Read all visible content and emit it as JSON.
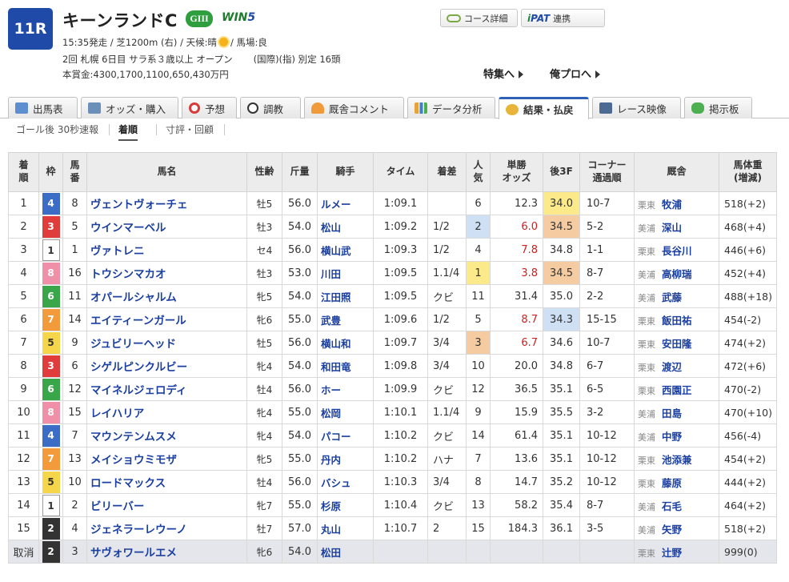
{
  "race": {
    "number": "11R",
    "name": "キーンランドC",
    "grade": "GIII",
    "win5_a": "WIN",
    "win5_b": "5",
    "info1_a": "15:35発走 / 芝1200m (右) / 天候:晴",
    "info1_b": "/ 馬場:良",
    "info2": "2回 札幌 6日目 サラ系３歳以上 オープン",
    "info2_class": "(国際)(指) 別定 16頭",
    "prize": "本賞金:4300,1700,1100,650,430万円"
  },
  "buttons": {
    "course": "コース詳細",
    "ipat_logo_a": "i",
    "ipat_logo_b": "PAT",
    "ipat_text": "連携"
  },
  "links": {
    "tokusyu": "特集へ",
    "orepro": "俺プロへ"
  },
  "tabs": [
    {
      "label": "出馬表"
    },
    {
      "label": "オッズ・購入"
    },
    {
      "label": "予想"
    },
    {
      "label": "調教"
    },
    {
      "label": "厩舎コメント"
    },
    {
      "label": "データ分析"
    },
    {
      "label": "結果・払戻"
    },
    {
      "label": "レース映像"
    },
    {
      "label": "掲示板"
    }
  ],
  "subtabs": [
    {
      "label": "ゴール後 30秒速報"
    },
    {
      "label": "着順"
    },
    {
      "label": "寸評・回顧"
    }
  ],
  "columns": {
    "rank": "着順",
    "waku": "枠",
    "umaban": "馬番",
    "horse": "馬名",
    "sex": "性齢",
    "weight": "斤量",
    "jockey": "騎手",
    "time": "タイム",
    "margin": "着差",
    "pop": "人気",
    "odds": "単勝オッズ",
    "last3f": "後3F",
    "corner": "コーナー通過順",
    "trainer": "厩舎",
    "bw": "馬体重(増減)"
  },
  "colors": {
    "waku1": "#ffffff",
    "waku2": "#333333",
    "waku3": "#e03c3c",
    "waku4": "#3b6cc6",
    "waku5": "#f5d54a",
    "waku6": "#3aa64a",
    "waku7": "#f39a3a",
    "waku8": "#f08fa8",
    "highlight_yellow": "#fbe98a",
    "highlight_orange": "#f5cba2",
    "highlight_blue": "#cfe0f5",
    "odds_red": "#d41c1c"
  },
  "rows": [
    {
      "rank": "1",
      "waku": "4",
      "umaban": "8",
      "horse": "ヴェントヴォーチェ",
      "sex": "牡5",
      "weight": "56.0",
      "jockey": "ルメー",
      "time": "1:09.1",
      "margin": "",
      "pop": "6",
      "odds": "12.3",
      "last3f": "34.0",
      "corner": "10-7",
      "region": "栗東",
      "trainer": "牧浦",
      "bw": "518(+2)",
      "hl_3f": "yellow"
    },
    {
      "rank": "2",
      "waku": "3",
      "umaban": "5",
      "horse": "ウインマーベル",
      "sex": "牡3",
      "weight": "54.0",
      "jockey": "松山",
      "time": "1:09.2",
      "margin": "1/2",
      "pop": "2",
      "odds": "6.0",
      "last3f": "34.5",
      "corner": "5-2",
      "region": "美浦",
      "trainer": "深山",
      "bw": "468(+4)",
      "hl_pop": "blue",
      "odds_hot": true,
      "hl_3f": "orange"
    },
    {
      "rank": "3",
      "waku": "1",
      "umaban": "1",
      "horse": "ヴァトレニ",
      "sex": "セ4",
      "weight": "56.0",
      "jockey": "横山武",
      "time": "1:09.3",
      "margin": "1/2",
      "pop": "4",
      "odds": "7.8",
      "last3f": "34.8",
      "corner": "1-1",
      "region": "栗東",
      "trainer": "長谷川",
      "bw": "446(+6)",
      "odds_hot": true
    },
    {
      "rank": "4",
      "waku": "8",
      "umaban": "16",
      "horse": "トウシンマカオ",
      "sex": "牡3",
      "weight": "53.0",
      "jockey": "川田",
      "time": "1:09.5",
      "margin": "1.1/4",
      "pop": "1",
      "odds": "3.8",
      "last3f": "34.5",
      "corner": "8-7",
      "region": "美浦",
      "trainer": "高柳瑞",
      "bw": "452(+4)",
      "hl_pop": "yellow",
      "odds_hot": true,
      "hl_3f": "orange"
    },
    {
      "rank": "5",
      "waku": "6",
      "umaban": "11",
      "horse": "オパールシャルム",
      "sex": "牝5",
      "weight": "54.0",
      "jockey": "江田照",
      "time": "1:09.5",
      "margin": "クビ",
      "pop": "11",
      "odds": "31.4",
      "last3f": "35.0",
      "corner": "2-2",
      "region": "美浦",
      "trainer": "武藤",
      "bw": "488(+18)"
    },
    {
      "rank": "6",
      "waku": "7",
      "umaban": "14",
      "horse": "エイティーンガール",
      "sex": "牝6",
      "weight": "55.0",
      "jockey": "武豊",
      "time": "1:09.6",
      "margin": "1/2",
      "pop": "5",
      "odds": "8.7",
      "last3f": "34.3",
      "corner": "15-15",
      "region": "栗東",
      "trainer": "飯田祐",
      "bw": "454(-2)",
      "odds_hot": true,
      "hl_3f": "blue"
    },
    {
      "rank": "7",
      "waku": "5",
      "umaban": "9",
      "horse": "ジュビリーヘッド",
      "sex": "牡5",
      "weight": "56.0",
      "jockey": "横山和",
      "time": "1:09.7",
      "margin": "3/4",
      "pop": "3",
      "odds": "6.7",
      "last3f": "34.6",
      "corner": "10-7",
      "region": "栗東",
      "trainer": "安田隆",
      "bw": "474(+2)",
      "hl_pop": "orange",
      "odds_hot": true
    },
    {
      "rank": "8",
      "waku": "3",
      "umaban": "6",
      "horse": "シゲルピンクルビー",
      "sex": "牝4",
      "weight": "54.0",
      "jockey": "和田竜",
      "time": "1:09.8",
      "margin": "3/4",
      "pop": "10",
      "odds": "20.0",
      "last3f": "34.8",
      "corner": "6-7",
      "region": "栗東",
      "trainer": "渡辺",
      "bw": "472(+6)"
    },
    {
      "rank": "9",
      "waku": "6",
      "umaban": "12",
      "horse": "マイネルジェロディ",
      "sex": "牡4",
      "weight": "56.0",
      "jockey": "ホー",
      "time": "1:09.9",
      "margin": "クビ",
      "pop": "12",
      "odds": "36.5",
      "last3f": "35.1",
      "corner": "6-5",
      "region": "栗東",
      "trainer": "西園正",
      "bw": "470(-2)"
    },
    {
      "rank": "10",
      "waku": "8",
      "umaban": "15",
      "horse": "レイハリア",
      "sex": "牝4",
      "weight": "55.0",
      "jockey": "松岡",
      "time": "1:10.1",
      "margin": "1.1/4",
      "pop": "9",
      "odds": "15.9",
      "last3f": "35.5",
      "corner": "3-2",
      "region": "美浦",
      "trainer": "田島",
      "bw": "470(+10)"
    },
    {
      "rank": "11",
      "waku": "4",
      "umaban": "7",
      "horse": "マウンテンムスメ",
      "sex": "牝4",
      "weight": "54.0",
      "jockey": "パコー",
      "time": "1:10.2",
      "margin": "クビ",
      "pop": "14",
      "odds": "61.4",
      "last3f": "35.1",
      "corner": "10-12",
      "region": "美浦",
      "trainer": "中野",
      "bw": "456(-4)"
    },
    {
      "rank": "12",
      "waku": "7",
      "umaban": "13",
      "horse": "メイショウミモザ",
      "sex": "牝5",
      "weight": "55.0",
      "jockey": "丹内",
      "time": "1:10.2",
      "margin": "ハナ",
      "pop": "7",
      "odds": "13.6",
      "last3f": "35.1",
      "corner": "10-12",
      "region": "栗東",
      "trainer": "池添兼",
      "bw": "454(+2)"
    },
    {
      "rank": "13",
      "waku": "5",
      "umaban": "10",
      "horse": "ロードマックス",
      "sex": "牡4",
      "weight": "56.0",
      "jockey": "バシュ",
      "time": "1:10.3",
      "margin": "3/4",
      "pop": "8",
      "odds": "14.7",
      "last3f": "35.2",
      "corner": "10-12",
      "region": "栗東",
      "trainer": "藤原",
      "bw": "444(+2)"
    },
    {
      "rank": "14",
      "waku": "1",
      "umaban": "2",
      "horse": "ビリーバー",
      "sex": "牝7",
      "weight": "55.0",
      "jockey": "杉原",
      "time": "1:10.4",
      "margin": "クビ",
      "pop": "13",
      "odds": "58.2",
      "last3f": "35.4",
      "corner": "8-7",
      "region": "美浦",
      "trainer": "石毛",
      "bw": "464(+2)"
    },
    {
      "rank": "15",
      "waku": "2",
      "umaban": "4",
      "horse": "ジェネラーレウーノ",
      "sex": "牡7",
      "weight": "57.0",
      "jockey": "丸山",
      "time": "1:10.7",
      "margin": "2",
      "pop": "15",
      "odds": "184.3",
      "last3f": "36.1",
      "corner": "3-5",
      "region": "美浦",
      "trainer": "矢野",
      "bw": "518(+2)"
    },
    {
      "rank": "取消",
      "waku": "2",
      "umaban": "3",
      "horse": "サヴォワールエメ",
      "sex": "牝6",
      "weight": "54.0",
      "jockey": "松田",
      "time": "",
      "margin": "",
      "pop": "",
      "odds": "",
      "last3f": "",
      "corner": "",
      "region": "栗東",
      "trainer": "辻野",
      "bw": "999(0)",
      "cancel": true
    }
  ]
}
